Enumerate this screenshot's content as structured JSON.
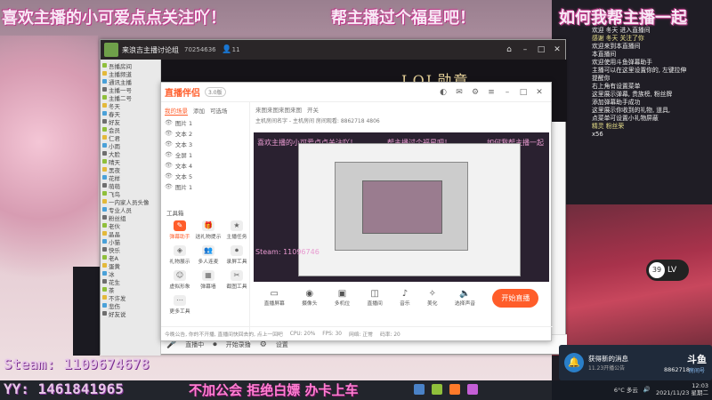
{
  "banners": {
    "left": "喜欢主播的小可爱点点关注吖！",
    "middle": "帮主播过个福星吧！",
    "right": "如何我帮主播一起"
  },
  "app": {
    "title": "来浪吉主播讨论组",
    "room_id": "70254636",
    "viewers": "11",
    "lol_badge": "LOL勋章"
  },
  "tree": {
    "items": [
      "吾播房间",
      "主播频道",
      "通讯主播",
      "主播一号",
      "主播二号",
      "冬天",
      "春天",
      "好友",
      "会员",
      "仁君",
      "小雨",
      "大脸",
      "晴天",
      "黑夜",
      "花样",
      "萌萌",
      "飞鸟",
      "一内家人员头像",
      "专业人员",
      "粉丝组",
      "老伙",
      "晶晶",
      "小猫",
      "快乐",
      "老A",
      "蛋黄",
      "冰",
      "花生",
      "茶",
      "不许发",
      "悲伤",
      "好友说"
    ]
  },
  "companion": {
    "logo": "直播伴侣",
    "version": "3.0版",
    "tabs": [
      "我的场景",
      "添加",
      "可选场"
    ],
    "scenes": [
      "图片 1",
      "文本 2",
      "文本 3",
      "全屏 1",
      "文本 4",
      "文本 5",
      "图片 1"
    ],
    "tools_label": "工具箱",
    "tools": [
      "弹幕助手",
      "送礼物提示",
      "主播任务",
      "礼物展示",
      "多人连麦",
      "录屏工具",
      "虚拟形象",
      "弹幕墙",
      "截图工具",
      "更多工具"
    ],
    "subtabs": [
      "来图来图来图来图",
      "开关"
    ],
    "info": "主机房间名字 - 主机房间   房间观看: 8862718   4806",
    "preview_overlay_left": "喜欢主播的小可爱点点关注吖！",
    "preview_overlay_mid": "帮主播过个福星吧！",
    "preview_overlay_right": "如何我帮主播一起",
    "preview_steam": "Steam: 11096746",
    "live_controls": [
      "直播屏幕",
      "摄像头",
      "多机位",
      "直播间",
      "音乐",
      "美化",
      "选择声音"
    ],
    "start_label": "开始直播",
    "status": [
      "今晚公告, 你的不开播, 直播间快回去的, 点上一回吧",
      "CPU: 20%",
      "FPS: 30",
      "网络: 正常",
      "码率: 20"
    ]
  },
  "bottom_bar": [
    "直播中",
    "开始录播",
    "设置"
  ],
  "chat": {
    "lines": [
      {
        "text": "欢迎 冬天 进入直播间",
        "hl": false
      },
      {
        "text": "感谢 冬天 关注了你",
        "hl": true
      },
      {
        "text": "欢迎来到本直播间",
        "hl": false
      },
      {
        "text": "本直播间",
        "hl": false
      },
      {
        "text": "欢迎使用斗鱼弹幕助手",
        "hl": false
      },
      {
        "text": "主播可以在这里设置你的, 左键拉伸",
        "hl": false
      },
      {
        "text": "提醒你",
        "hl": false
      },
      {
        "text": "右上角有设置菜单",
        "hl": false
      },
      {
        "text": "这里展示弹幕, 贵族榜, 粉丝牌",
        "hl": false
      },
      {
        "text": "添加弹幕助手成功",
        "hl": false
      },
      {
        "text": "",
        "hl": false
      },
      {
        "text": "这里展示你收到的礼物, 道具,",
        "hl": false
      },
      {
        "text": "点菜单可设置小礼物屏蔽",
        "hl": false
      },
      {
        "text": "精灵 粉丝荣",
        "hl": true
      },
      {
        "text": "x56",
        "hl": false
      }
    ]
  },
  "level": {
    "number": "39",
    "label": "LV"
  },
  "notification": {
    "title": "获得新的消息",
    "subtitle": "11.23开播公告",
    "brand": "斗鱼",
    "brand_sub": "房间号"
  },
  "room_number": "8862718",
  "steam_text": "Steam: 1109674678",
  "yy_text": "YY: 1461841965",
  "slogan": "不加公会 拒绝白嫖 办卡上车",
  "tray": {
    "weather": "6°C 多云",
    "time": "12:03",
    "date": "2021/11/23 星期二"
  }
}
